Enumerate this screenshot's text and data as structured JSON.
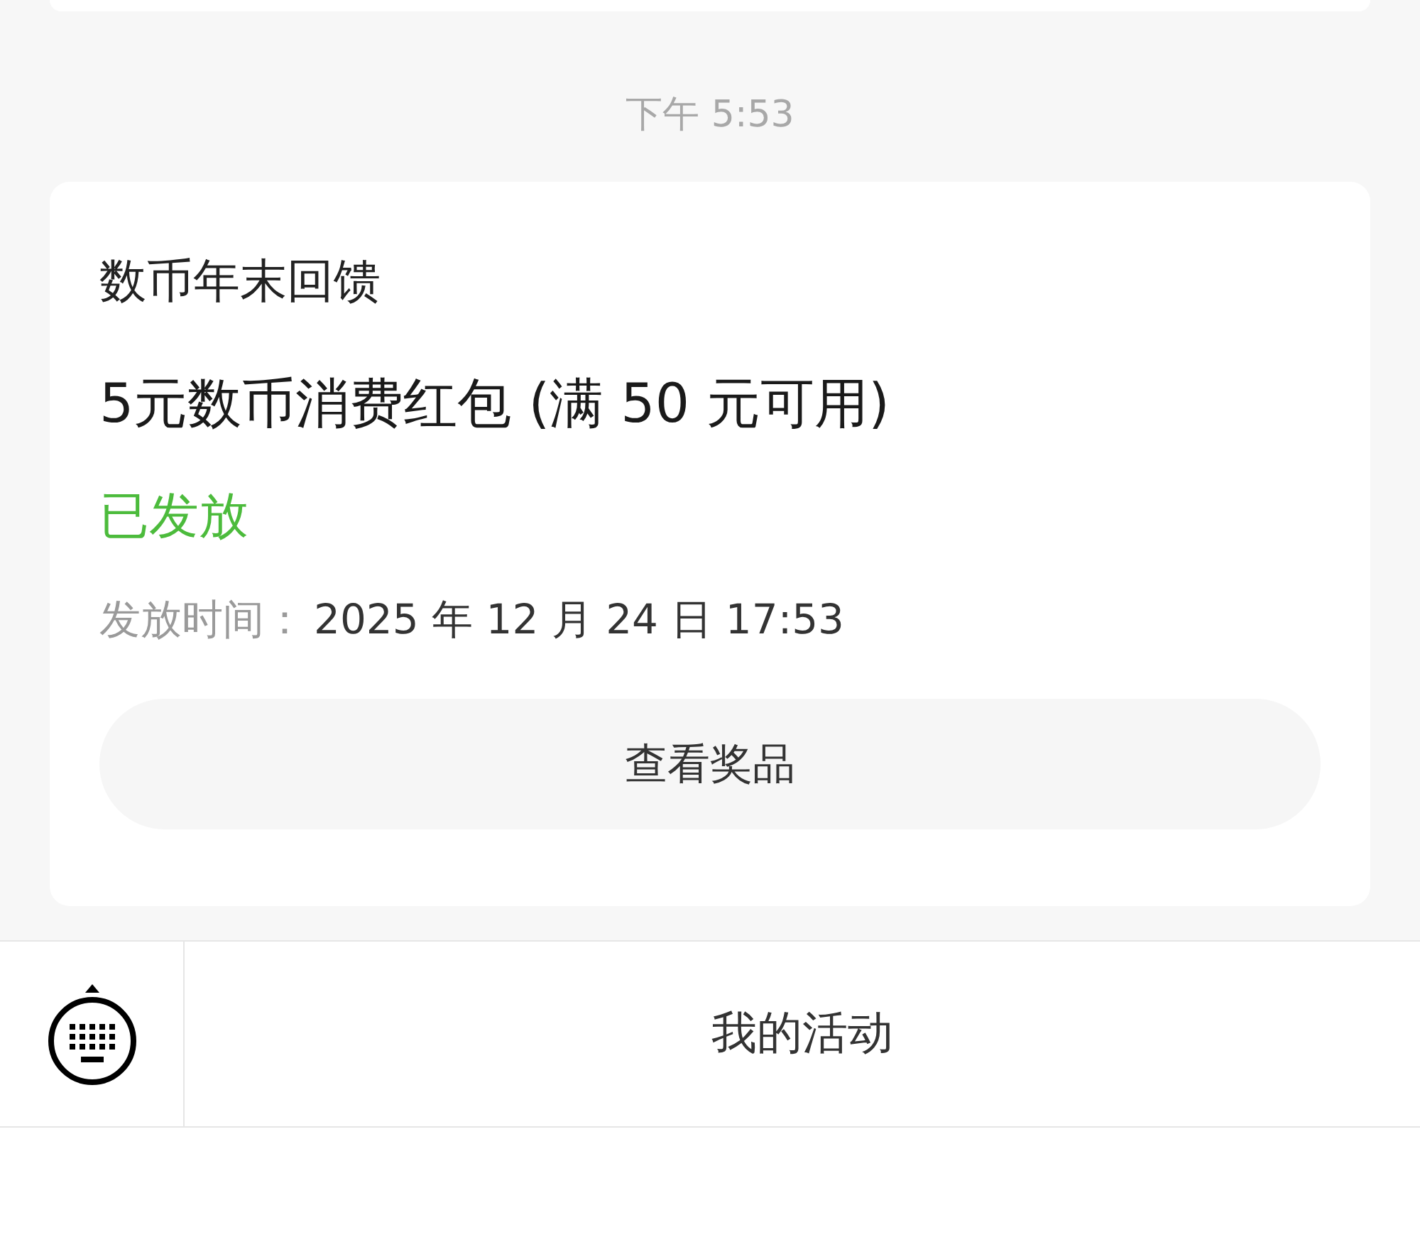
{
  "timestamp": "下午 5:53",
  "card": {
    "title": "数币年末回馈",
    "prize": "5元数币消费红包 (满 50 元可用)",
    "status": "已发放",
    "issued_label": "发放时间：",
    "issued_value": "2025 年 12 月 24 日 17:53",
    "button": "查看奖品"
  },
  "bottom_bar": {
    "menu": "我的活动"
  }
}
